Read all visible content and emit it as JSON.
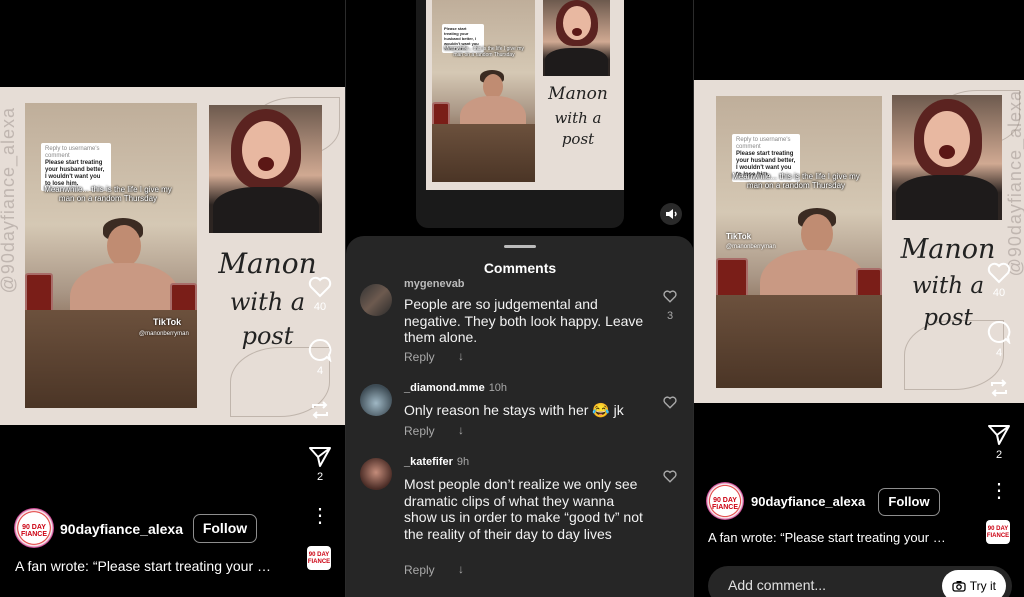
{
  "post": {
    "username": "90dayfiance_alexa",
    "follow_label": "Follow",
    "caption": "A fan wrote: “Please start treating your …",
    "watermark": "@90dayfiance_alexa",
    "avatar_text": "90 DAY FIANCE",
    "overlay_title_line1": "Manon",
    "overlay_title_line2": "with a",
    "overlay_title_line3": "post",
    "reply_note": "Reply to username's comment",
    "reply_quote": "Please start treating your husband better, I wouldn't want you to lose him.",
    "meanwhile": "Meanwhile... this is the life I give my man on a random Thursday",
    "tiktok_label": "TikTok",
    "tiktok_handle": "@manonberryman",
    "likes": "40",
    "comments": "4",
    "shares": "2"
  },
  "comments_sheet": {
    "title": "Comments",
    "reply_label": "Reply",
    "add_placeholder": "Add comment...",
    "try_label": "Try it",
    "items": [
      {
        "user": "mygenevab",
        "time": "",
        "text": "People are so judgemental and negative. They both look happy. Leave them alone.",
        "likes": "3"
      },
      {
        "user": "_diamond.mme",
        "time": "10h",
        "text": "Only reason he stays with her 😂 jk",
        "likes": ""
      },
      {
        "user": "_katefifer",
        "time": "9h",
        "text": "Most people don’t realize we only see dramatic clips of what they wanna show us in order to make “good tv” not the reality of their day to day lives",
        "likes": ""
      }
    ]
  },
  "icons": [
    "heart-icon",
    "comment-icon",
    "repost-icon",
    "send-icon",
    "more-icon",
    "mute-icon",
    "camera-icon",
    "chevron-down-icon"
  ],
  "colors": {
    "background": "#000000",
    "sheet": "#262626",
    "muted_text": "#a8a8a8",
    "post_bg": "#e6ddd6"
  }
}
